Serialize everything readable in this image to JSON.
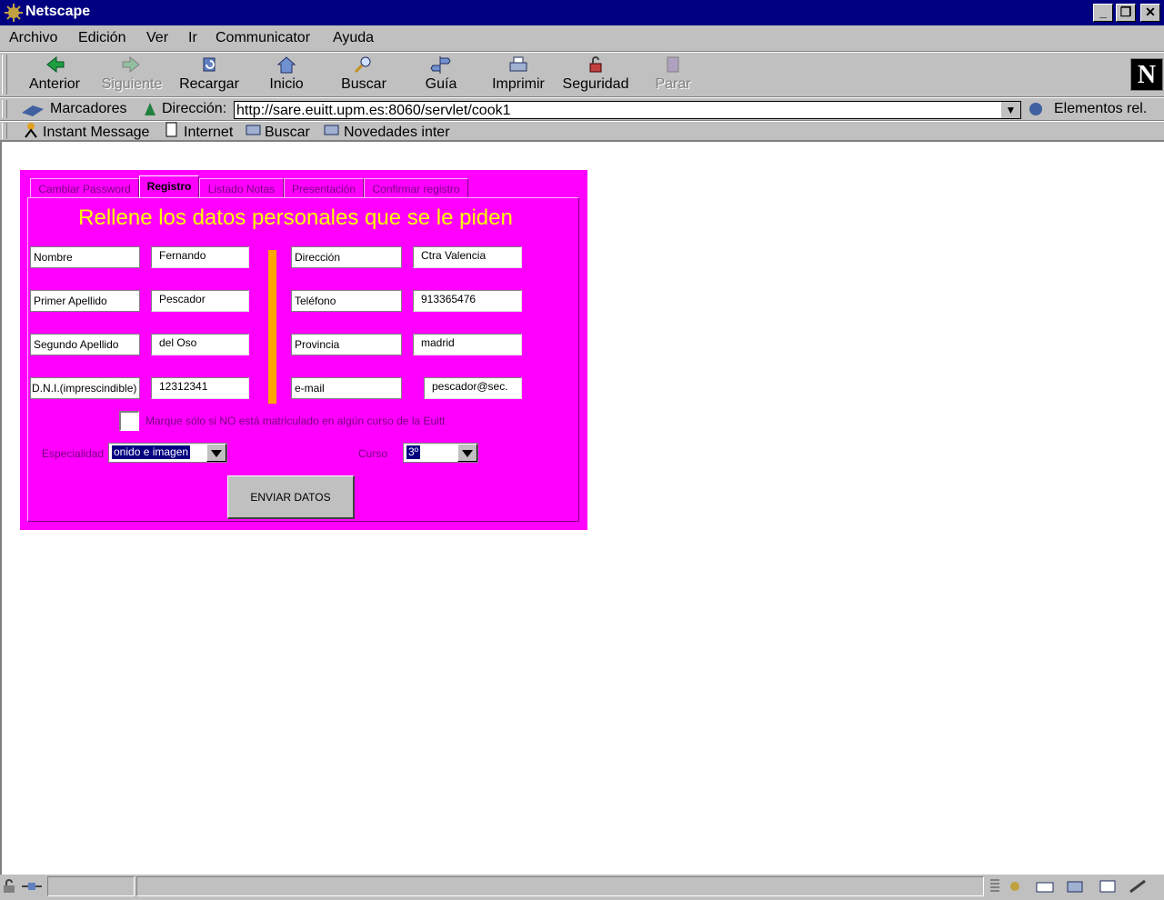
{
  "window": {
    "title": "Netscape"
  },
  "menu": [
    "Archivo",
    "Edición",
    "Ver",
    "Ir",
    "Communicator",
    "Ayuda"
  ],
  "toolbar": [
    {
      "label": "Anterior",
      "icon": "back-arrow-icon",
      "enabled": true
    },
    {
      "label": "Siguiente",
      "icon": "forward-arrow-icon",
      "enabled": false
    },
    {
      "label": "Recargar",
      "icon": "reload-icon",
      "enabled": true
    },
    {
      "label": "Inicio",
      "icon": "home-icon",
      "enabled": true
    },
    {
      "label": "Buscar",
      "icon": "search-icon",
      "enabled": true
    },
    {
      "label": "Guía",
      "icon": "guide-icon",
      "enabled": true
    },
    {
      "label": "Imprimir",
      "icon": "printer-icon",
      "enabled": true
    },
    {
      "label": "Seguridad",
      "icon": "lock-icon",
      "enabled": true
    },
    {
      "label": "Parar",
      "icon": "stop-icon",
      "enabled": false
    }
  ],
  "location": {
    "bookmarks": "Marcadores",
    "address_label": "Dirección:",
    "url": "http://sare.euitt.upm.es:8060/servlet/cook1",
    "related": "Elementos rel."
  },
  "personal_toolbar": [
    "Instant Message",
    "Internet",
    "Buscar",
    "Novedades inter"
  ],
  "tabs": [
    {
      "label": "Cambiar Password",
      "selected": false
    },
    {
      "label": "Registro",
      "selected": true
    },
    {
      "label": "Listado Notas",
      "selected": false
    },
    {
      "label": "Presentación",
      "selected": false
    },
    {
      "label": "Confirmar registro",
      "selected": false
    }
  ],
  "form": {
    "heading": "Rellene los datos personales que se le piden",
    "left_fields": [
      {
        "label": "Nombre",
        "value": "Fernando"
      },
      {
        "label": "Primer Apellido",
        "value": "Pescador"
      },
      {
        "label": "Segundo Apellido",
        "value": "del Oso"
      },
      {
        "label": "D.N.I.(imprescindible)",
        "value": "12312341"
      }
    ],
    "right_fields": [
      {
        "label": "Dirección",
        "value": "Ctra Valencia"
      },
      {
        "label": "Teléfono",
        "value": "913365476"
      },
      {
        "label": "Provincia",
        "value": "madrid"
      },
      {
        "label": "e-mail",
        "value": "pescador@sec."
      }
    ],
    "checkbox_label": "Marque sólo si NO está matriculado en algún curso de la Euitt",
    "especialidad_label": "Especialidad",
    "especialidad_value": "onido e imagen",
    "curso_label": "Curso",
    "curso_value": "3º",
    "submit": "ENVIAR DATOS"
  },
  "colors": {
    "applet_bg": "#ff00ff",
    "heading": "#ffff00",
    "divider": "#ffa500",
    "titlebar": "#000080"
  }
}
